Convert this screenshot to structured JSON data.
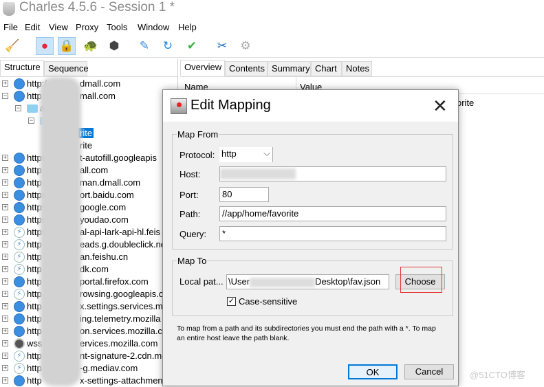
{
  "window": {
    "title": "Charles 4.5.6 - Session 1 *"
  },
  "menu": [
    "File",
    "Edit",
    "View",
    "Proxy",
    "Tools",
    "Window",
    "Help"
  ],
  "toolbar": [
    {
      "icon": "broom-icon",
      "glyph": "🧹",
      "active": false
    },
    {
      "icon": "record-icon",
      "glyph": "●",
      "active": true
    },
    {
      "icon": "ssl-proxy-lock-icon",
      "glyph": "🔒",
      "active": true
    },
    {
      "icon": "throttle-turtle-icon",
      "glyph": "🐢",
      "active": false
    },
    {
      "icon": "breakpoint-stop-icon",
      "glyph": "⬢",
      "active": false
    },
    {
      "icon": "compose-pen-icon",
      "glyph": "✎",
      "active": false
    },
    {
      "icon": "repeat-icon",
      "glyph": "↻",
      "active": false
    },
    {
      "icon": "validate-check-icon",
      "glyph": "✔",
      "active": false
    },
    {
      "icon": "tools-icon",
      "glyph": "✂",
      "active": false
    },
    {
      "icon": "settings-gear-icon",
      "glyph": "⚙",
      "active": false
    }
  ],
  "left_tabs": [
    "Structure",
    "Sequence"
  ],
  "tree": [
    {
      "pm": "+",
      "icon": "globe",
      "text": "http:/",
      "tail": "dmall.com"
    },
    {
      "pm": "−",
      "icon": "globe",
      "text": "http:/",
      "tail": "mall.com"
    },
    {
      "pm": "−",
      "icon": "folder",
      "text": "a",
      "level": 1
    },
    {
      "pm": "−",
      "icon": "folder",
      "text": "",
      "level": 2
    },
    {
      "icon": "none",
      "text": "rite",
      "level": 3,
      "selected": true
    },
    {
      "icon": "none",
      "text": "rite",
      "level": 3
    },
    {
      "pm": "+",
      "icon": "globe",
      "text": "https",
      "tail": "t-autofill.googleapis"
    },
    {
      "pm": "+",
      "icon": "globe",
      "text": "http:",
      "tail": "all.com"
    },
    {
      "pm": "+",
      "icon": "globe",
      "text": "http:",
      "tail": "man.dmall.com"
    },
    {
      "pm": "+",
      "icon": "globe",
      "text": "https",
      "tail": "ort.baidu.com"
    },
    {
      "pm": "+",
      "icon": "globe",
      "text": "https",
      "tail": "google.com"
    },
    {
      "pm": "+",
      "icon": "globe",
      "text": "https",
      "tail": "youdao.com"
    },
    {
      "pm": "+",
      "icon": "bolt",
      "text": "https",
      "tail": "al-api-lark-api-hl.feis"
    },
    {
      "pm": "+",
      "icon": "bolt",
      "text": "http",
      "tail": "eads.g.doubleclick.ne"
    },
    {
      "pm": "+",
      "icon": "bolt",
      "text": "http",
      "tail": "an.feishu.cn"
    },
    {
      "pm": "+",
      "icon": "bolt",
      "text": "http",
      "tail": "dk.com"
    },
    {
      "pm": "+",
      "icon": "globe",
      "text": "http",
      "tail": "portal.firefox.com"
    },
    {
      "pm": "+",
      "icon": "bolt",
      "text": "http",
      "tail": "rowsing.googleapis.c"
    },
    {
      "pm": "+",
      "icon": "globe",
      "text": "http",
      "tail": "x.settings.services.mo"
    },
    {
      "pm": "+",
      "icon": "globe",
      "text": "http",
      "tail": "ing.telemetry.mozilla"
    },
    {
      "pm": "+",
      "icon": "globe",
      "text": "http",
      "tail": "on.services.mozilla.co"
    },
    {
      "pm": "+",
      "icon": "ws",
      "text": "wss",
      "tail": "ervices.mozilla.com"
    },
    {
      "pm": "+",
      "icon": "bolt",
      "text": "http",
      "tail": "nt-signature-2.cdn.mo"
    },
    {
      "pm": "+",
      "icon": "bolt",
      "text": "http",
      "tail": "-g.mediav.com"
    },
    {
      "pm": "+",
      "icon": "globe",
      "text": "http",
      "tail": "x-settings-attachment"
    }
  ],
  "right_tabs": [
    "Overview",
    "Contents",
    "Summary",
    "Chart",
    "Notes"
  ],
  "overview": {
    "col_name": "Name",
    "col_value": "Value",
    "value_fragment": "orite"
  },
  "dialog": {
    "title": "Edit Mapping",
    "map_from": {
      "legend": "Map From",
      "protocol_label": "Protocol:",
      "protocol": "http",
      "host_label": "Host:",
      "host": "",
      "port_label": "Port:",
      "port": "80",
      "path_label": "Path:",
      "path": "//app/home/favorite",
      "query_label": "Query:",
      "query": "*"
    },
    "map_to": {
      "legend": "Map To",
      "local_path_label": "Local pat...",
      "local_path_start": "\\User",
      "local_path_end": "Desktop\\fav.json",
      "choose": "Choose",
      "case_sensitive": "Case-sensitive",
      "case_checked": true
    },
    "hint": "To map from a path and its subdirectories you must end the path with a *. To map an entire host leave the path blank.",
    "ok": "OK",
    "cancel": "Cancel"
  },
  "watermark": "@51CTO博客",
  "colors": {
    "selection": "#0078d7",
    "highlight_box": "#e53935",
    "focus_border": "#0078d7"
  }
}
